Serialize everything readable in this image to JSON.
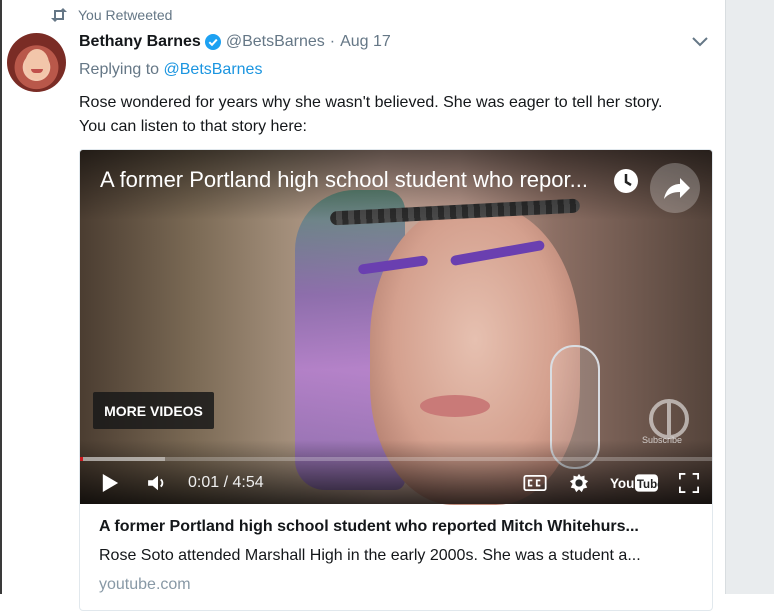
{
  "retweet": {
    "label": "You Retweeted",
    "icon": "retweet-icon"
  },
  "tweet": {
    "author_name": "Bethany Barnes",
    "verified": true,
    "handle": "@BetsBarnes",
    "separator": "·",
    "date": "Aug 17",
    "replying_prefix": "Replying to",
    "replying_to": "@BetsBarnes",
    "text_line1": "Rose wondered for years why she wasn't believed. She was eager to tell her story.",
    "text_line2": "You can listen to that story here:"
  },
  "video": {
    "title": "A former Portland high school student who repor...",
    "more_videos_label": "MORE VIDEOS",
    "subscribe_label": "Subscribe",
    "current_time": "0:01",
    "time_separator": "/",
    "duration": "4:54",
    "progress_fraction": 0.004,
    "buffered_fraction": 0.135,
    "youtube_label": "YouTube"
  },
  "card": {
    "title": "A former Portland high school student who reported Mitch Whitehurs...",
    "description": "Rose Soto attended Marshall High in the early 2000s. She was a student a...",
    "domain": "youtube.com"
  },
  "colors": {
    "link": "#1b95e0",
    "secondary_text": "#657786",
    "verified": "#1da1f2",
    "progress": "#cc181e"
  }
}
